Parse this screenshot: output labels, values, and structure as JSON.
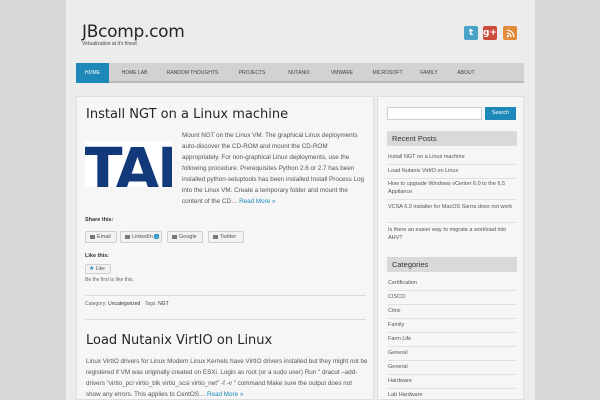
{
  "site": {
    "title": "JBcomp.com",
    "tagline": "Virtualization at it's finest"
  },
  "social": {
    "twitter": "t",
    "googleplus": "g+",
    "rss": "rss"
  },
  "nav": {
    "items": [
      "HOME",
      "HOME LAB",
      "RANDOM THOUGHTS",
      "PROJECTS",
      "NUTANIX",
      "VMWARE",
      "MICROSOFT",
      "FAMILY",
      "ABOUT"
    ]
  },
  "posts": [
    {
      "title": "Install NGT on a Linux machine",
      "thumb_text": "TAN",
      "excerpt": "Mount NGT on the Linux VM. The graphical Linux deployments auto-discover the CD-ROM and mount the CD-ROM appropriately. For non-graphical Linux deployments, use the following procedure. Prerequisites Python 2.6 or 2.7 has been installed python-setuptools has been installed Install Process Log into the Linux VM. Create a temporary folder and mount the content of the CD…",
      "read_more": "Read More »"
    },
    {
      "title": "Load Nutanix VirtIO on Linux",
      "excerpt": "Linux VirtIO drivers for Linux Modern Linux Kernels have VirtIO drivers installed but they might not be registered if VM was originally created on ESXi. Login as root (or a sudo user) Run \" dracut –add-drivers \"virtio_pci virtio_blk virtio_scsi virtio_net\" -f -v \" command Make sure the output does not show any errors. This applies to CentOS…",
      "read_more": "Read More »"
    }
  ],
  "share": {
    "heading": "Share this:",
    "buttons": {
      "email": "Email",
      "linkedin": "LinkedIn",
      "linkedin_count": "3",
      "google": "Google",
      "twitter": "Twitter"
    }
  },
  "like": {
    "heading": "Like this:",
    "button": "Like",
    "note": "Be the first to like this."
  },
  "post_meta": {
    "category_label": "Category:",
    "category": "Uncategorized",
    "tags_label": "Tags:",
    "tag": "NGT"
  },
  "sidebar": {
    "search": {
      "placeholder": "",
      "button": "Search"
    },
    "recent_posts": {
      "heading": "Recent Posts",
      "items": [
        "Install NGT on a Linux machine",
        "Load Nutanix VirtIO on Linux",
        "How to upgrade Windows vCenter 6.0 to the 6.5 Appliance",
        "VCSA 6.0 installer for MacOS Sierra does not work",
        "Is there an easier way to migrate a workload into AHV?"
      ]
    },
    "categories": {
      "heading": "Categories",
      "items": [
        "Certification",
        "CISCO",
        "Citrix",
        "Family",
        "Farm Life",
        "General",
        "General",
        "Hardware",
        "Lab Hardware"
      ]
    }
  },
  "colors": {
    "accent": "#1e88b8",
    "background": "#d7d7d7",
    "page": "#ececec"
  }
}
